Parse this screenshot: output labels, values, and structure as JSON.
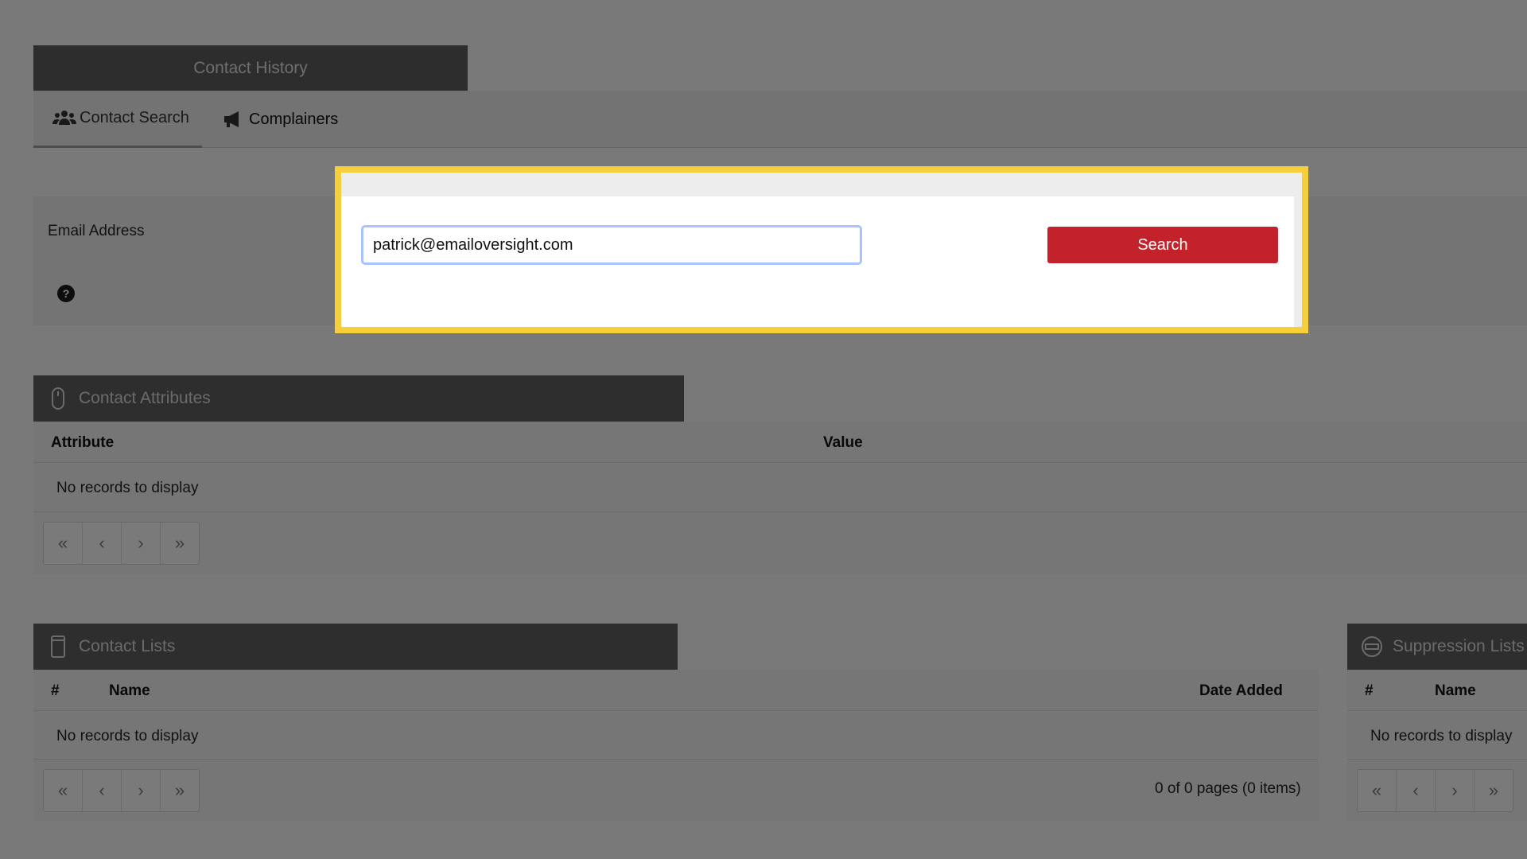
{
  "header": {
    "title": "Contact History"
  },
  "tabs": [
    {
      "label": "Contact Search",
      "icon": "users-icon"
    },
    {
      "label": "Complainers",
      "icon": "megaphone-icon"
    }
  ],
  "search": {
    "label": "Email Address",
    "value": "patrick@emailoversight.com",
    "button": "Search",
    "help": "?"
  },
  "contact_attributes": {
    "title": "Contact Attributes",
    "columns": [
      "Attribute",
      "Value"
    ],
    "empty": "No records to display",
    "pager": [
      "«",
      "‹",
      "›",
      "»"
    ]
  },
  "contact_lists": {
    "title": "Contact Lists",
    "columns": [
      "#",
      "Name",
      "Date Added"
    ],
    "empty": "No records to display",
    "pager": [
      "«",
      "‹",
      "›",
      "»"
    ],
    "page_info": "0 of 0 pages (0 items)"
  },
  "suppression_lists": {
    "title": "Suppression Lists",
    "columns": [
      "#",
      "Name"
    ],
    "empty": "No records to display",
    "pager": [
      "«",
      "‹",
      "›",
      "»"
    ]
  },
  "colors": {
    "accent": "#c4222b",
    "highlight": "#f6cf3a"
  }
}
